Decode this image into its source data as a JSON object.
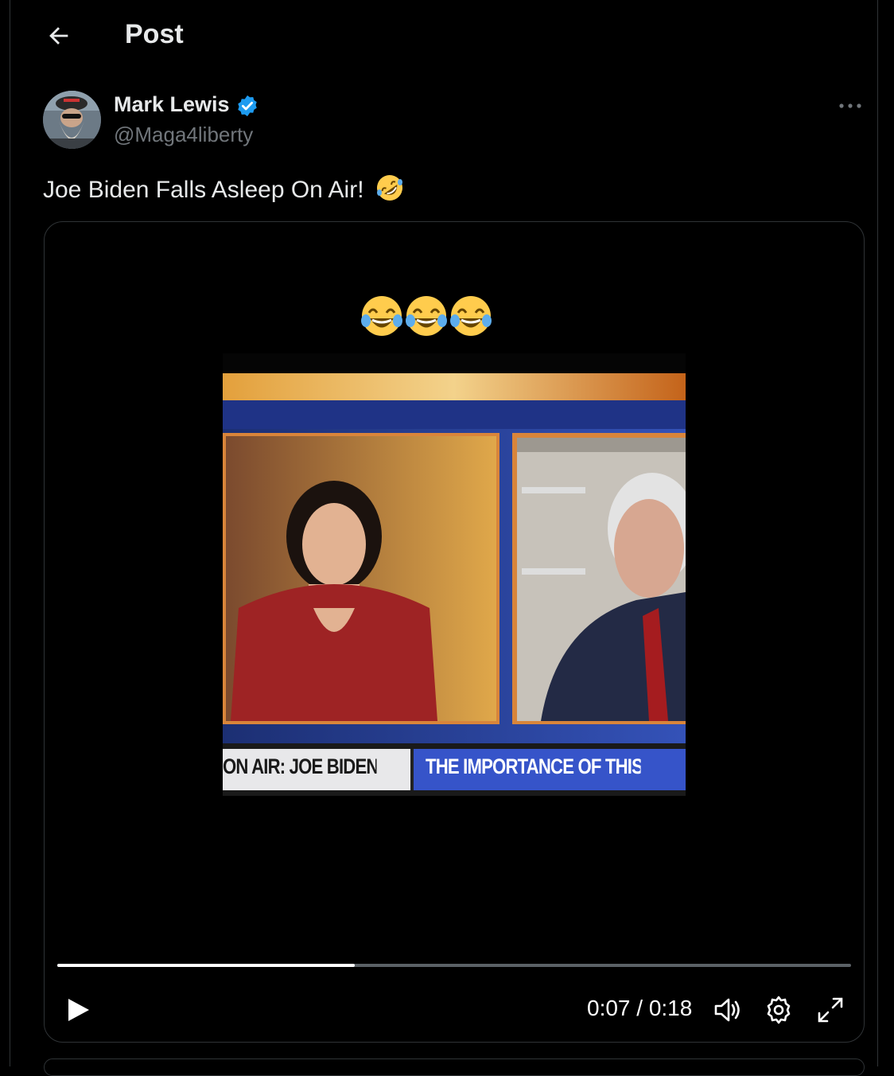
{
  "header": {
    "title": "Post",
    "back_icon": "arrow-left-icon"
  },
  "post": {
    "author_name": "Mark Lewis",
    "author_handle": "@Maga4liberty",
    "verified": true,
    "text": "Joe Biden Falls Asleep On Air!",
    "text_emoji": "rolling-on-floor-laughing-emoji",
    "more_icon": "more-horizontal-icon"
  },
  "media": {
    "overlay_emoji": "face-with-tears-of-joy-emoji",
    "overlay_emoji_count": 3,
    "ticker_left": "ON AIR: JOE BIDEN",
    "ticker_right": "THE IMPORTANCE OF THIS I",
    "time_label": "0:07 / 0:18",
    "progress": 0.375
  },
  "colors": {
    "verified_blue": "#1d9bf0",
    "muted_text": "#71767b",
    "border": "#2f3336"
  }
}
